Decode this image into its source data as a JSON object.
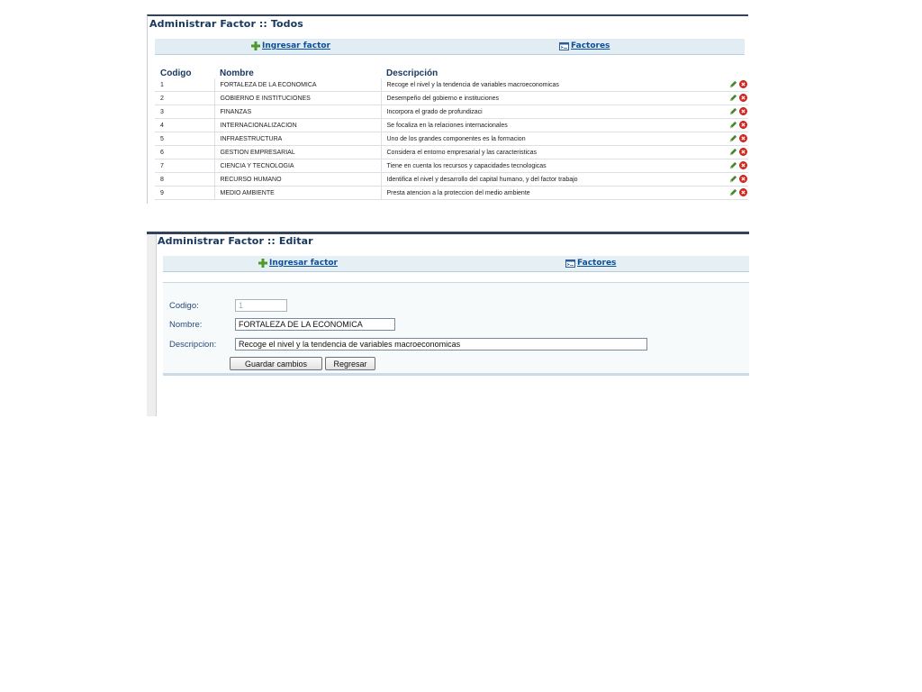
{
  "list_panel": {
    "title": "Administrar Factor :: Todos",
    "toolbar": {
      "add_label": "Ingresar factor",
      "factores_label": "Factores"
    },
    "columns": {
      "codigo": "Codigo",
      "nombre": "Nombre",
      "descripcion": "Descripción"
    },
    "rows": [
      {
        "codigo": "1",
        "nombre": "FORTALEZA DE LA ECONOMICA",
        "descripcion": "Recoge el nivel y la tendencia de variables macroeconomicas"
      },
      {
        "codigo": "2",
        "nombre": "GOBIERNO E INSTITUCIONES",
        "descripcion": "Desempeño del gobierno e instituciones"
      },
      {
        "codigo": "3",
        "nombre": "FINANZAS",
        "descripcion": "Incorpora el grado de profundizaci"
      },
      {
        "codigo": "4",
        "nombre": "INTERNACIONALIZACION",
        "descripcion": "Se focaliza en la relaciones internacionales"
      },
      {
        "codigo": "5",
        "nombre": "INFRAESTRUCTURA",
        "descripcion": "Uno de los grandes componentes es la formacion"
      },
      {
        "codigo": "6",
        "nombre": "GESTION EMPRESARIAL",
        "descripcion": "Considera el entorno empresarial y las caracteristicas"
      },
      {
        "codigo": "7",
        "nombre": "CIENCIA Y TECNOLOGIA",
        "descripcion": "Tiene en cuenta los recursos y capacidades tecnologicas"
      },
      {
        "codigo": "8",
        "nombre": "RECURSO HUMANO",
        "descripcion": "Identifica el nivel y desarrollo del capital humano, y del factor trabajo"
      },
      {
        "codigo": "9",
        "nombre": "MEDIO AMBIENTE",
        "descripcion": "Presta atencion a la proteccion del medio ambiente"
      }
    ],
    "row_actions": {
      "edit_icon": "pencil-icon",
      "delete_icon": "red-x-circle-icon"
    }
  },
  "edit_panel": {
    "title": "Administrar Factor :: Editar",
    "toolbar": {
      "add_label": "Ingresar factor",
      "factores_label": "Factores"
    },
    "form": {
      "codigo_label": "Codigo:",
      "codigo_value": "1",
      "nombre_label": "Nombre:",
      "nombre_value": "FORTALEZA DE LA ECONOMICA",
      "descripcion_label": "Descripcion:",
      "descripcion_value": "Recoge el nivel y la tendencia de variables macroeconomicas",
      "save_label": "Guardar cambios",
      "back_label": "Regresar"
    }
  },
  "colors": {
    "title_text": "#17375e",
    "link_text": "#0b4f9c",
    "toolbar_bg": "#e1edf3",
    "header_bar": "#34435a",
    "edit_icon_green": "#3e8e2a",
    "delete_icon_red": "#d8261f"
  }
}
